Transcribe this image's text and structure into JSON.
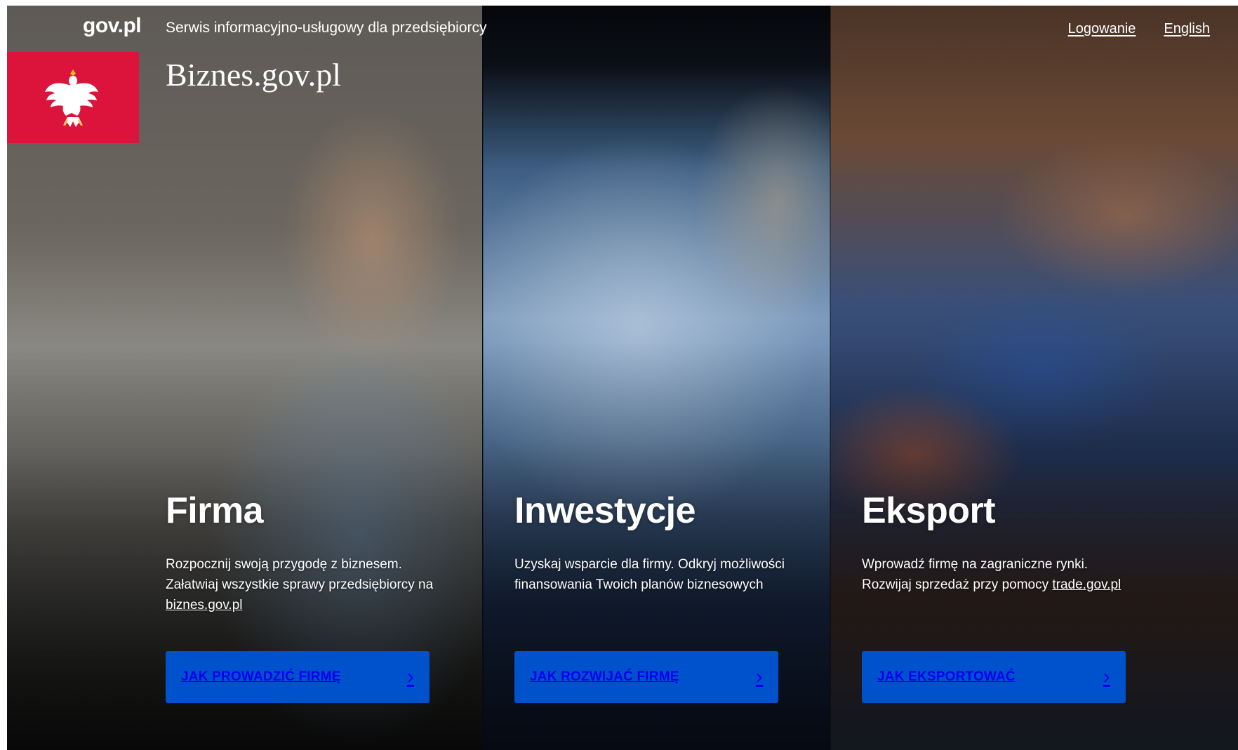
{
  "header": {
    "gov_logo": "gov.pl",
    "tagline": "Serwis informacyjno-usługowy dla przedsiębiorcy",
    "brand": "Biznes.gov.pl",
    "login": "Logowanie",
    "language": "English",
    "emblem_color": "#dc143c"
  },
  "panels": [
    {
      "title": "Firma",
      "text": "Rozpocznij swoją przygodę z biznesem. Załatwiaj wszystkie sprawy przedsiębiorcy na",
      "link": "biznes.gov.pl",
      "cta": "JAK PROWADZIĆ FIRMĘ"
    },
    {
      "title": "Inwestycje",
      "text": "Uzyskaj wsparcie dla firmy. Odkryj możliwości finansowania Twoich planów biznesowych",
      "cta": "JAK ROZWIJAĆ FIRMĘ"
    },
    {
      "title": "Eksport",
      "text": "Wprowadź firmę na zagraniczne rynki. Rozwijaj sprzedaż przy pomocy",
      "link": "trade.gov.pl",
      "cta": "JAK EKSPORTOWAĆ"
    }
  ],
  "icons": {
    "cta": "chevron-right-icon",
    "emblem": "white-eagle-icon"
  },
  "colors": {
    "cta_bg": "#0052cc",
    "text": "#ffffff"
  }
}
